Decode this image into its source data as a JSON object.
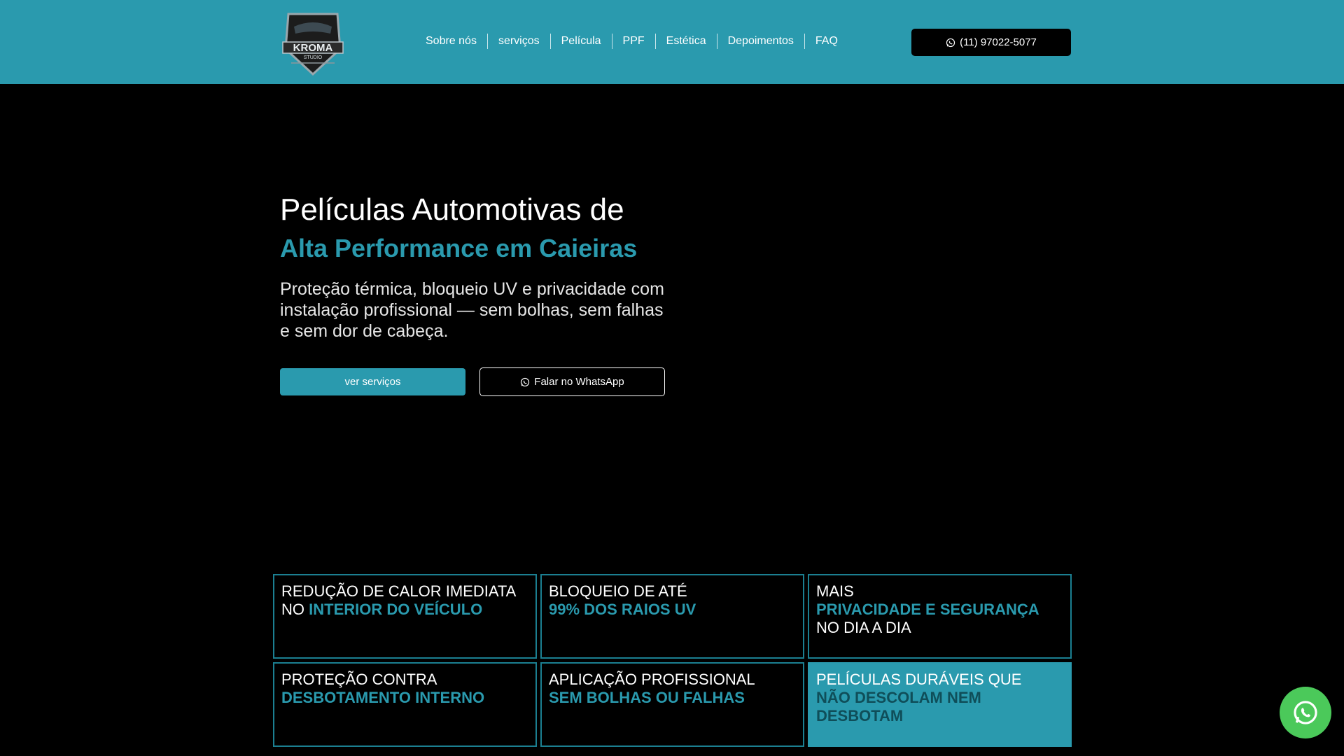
{
  "brand": {
    "logo_top": "KROMA",
    "logo_bottom": "STUDIO"
  },
  "nav": {
    "items": [
      {
        "label": "Sobre nós"
      },
      {
        "label": "serviços"
      },
      {
        "label": "Película"
      },
      {
        "label": "PPF"
      },
      {
        "label": "Estética"
      },
      {
        "label": "Depoimentos"
      },
      {
        "label": "FAQ"
      }
    ]
  },
  "header": {
    "phone_label": "(11) 97022-5077"
  },
  "hero": {
    "title_line1": "Películas Automotivas de",
    "title_line2": "Alta Performance em Caieiras",
    "subtitle": "Proteção térmica, bloqueio UV e privacidade com instalação profissional — sem bolhas, sem falhas e sem dor de cabeça.",
    "primary_cta": "ver serviços",
    "secondary_cta": "Falar no WhatsApp"
  },
  "features": [
    {
      "pre": "REDUÇÃO DE CALOR IMEDIATA NO ",
      "highlight": "INTERIOR DO VEÍCULO",
      "post": ""
    },
    {
      "pre": "BLOQUEIO DE ATÉ",
      "highlight": "99% DOS RAIOS UV",
      "post": ""
    },
    {
      "pre": "MAIS",
      "highlight": "PRIVACIDADE E SEGURANÇA",
      "post": "NO DIA A DIA"
    },
    {
      "pre": "PROTEÇÃO CONTRA",
      "highlight": "DESBOTAMENTO INTERNO",
      "post": ""
    },
    {
      "pre": "APLICAÇÃO PROFISSIONAL",
      "highlight": "SEM BOLHAS OU FALHAS",
      "post": ""
    },
    {
      "pre": "PELÍCULAS DURÁVEIS QUE",
      "highlight": "NÃO DESCOLAM NEM DESBOTAM",
      "post": ""
    }
  ],
  "colors": {
    "accent": "#2a9aae",
    "background": "#000000",
    "whatsapp": "#4bc95a"
  },
  "icons": {
    "phone_button": "whatsapp-icon",
    "floating": "whatsapp-icon"
  }
}
